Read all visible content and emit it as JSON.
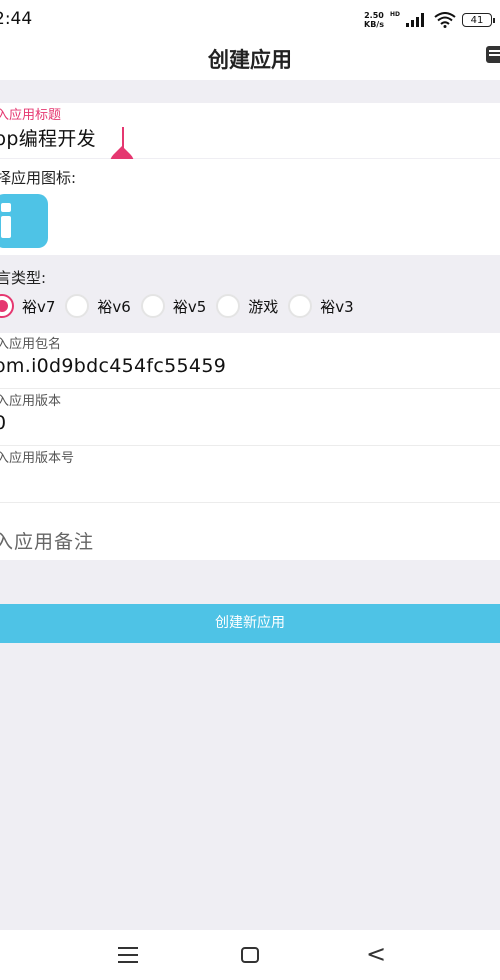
{
  "status_bar": {
    "time": "2:44",
    "net_speed_value": "2.50",
    "net_speed_unit": "KB/s",
    "hd_label": "HD",
    "battery": "41"
  },
  "header": {
    "title": "创建应用"
  },
  "form": {
    "title_hint": "入应用标题",
    "title_value": "pp编程开发",
    "icon_label": "择应用图标:",
    "language_label": "言类型:",
    "language_options": [
      "裕v7",
      "裕v6",
      "裕v5",
      "游戏",
      "裕v3"
    ],
    "language_selected": "裕v7",
    "package_hint": "入应用包名",
    "package_value": "om.i0d9bdc454fc55459",
    "version_hint": "入应用版本",
    "version_value": "0",
    "version_code_hint": "入应用版本号",
    "version_code_value": "",
    "notes_placeholder": "入应用备注"
  },
  "actions": {
    "create_button": "创建新应用"
  },
  "colors": {
    "accent_pink": "#e53770",
    "button_blue": "#4ec3e6",
    "background": "#efeef3"
  },
  "icons": {
    "status": [
      "signal-icon",
      "wifi-icon",
      "battery-icon"
    ],
    "header_menu": "menu-icon",
    "app_icon": "info-letter-i-icon",
    "nav": [
      "nav-menu-icon",
      "nav-home-icon",
      "nav-back-icon"
    ]
  }
}
